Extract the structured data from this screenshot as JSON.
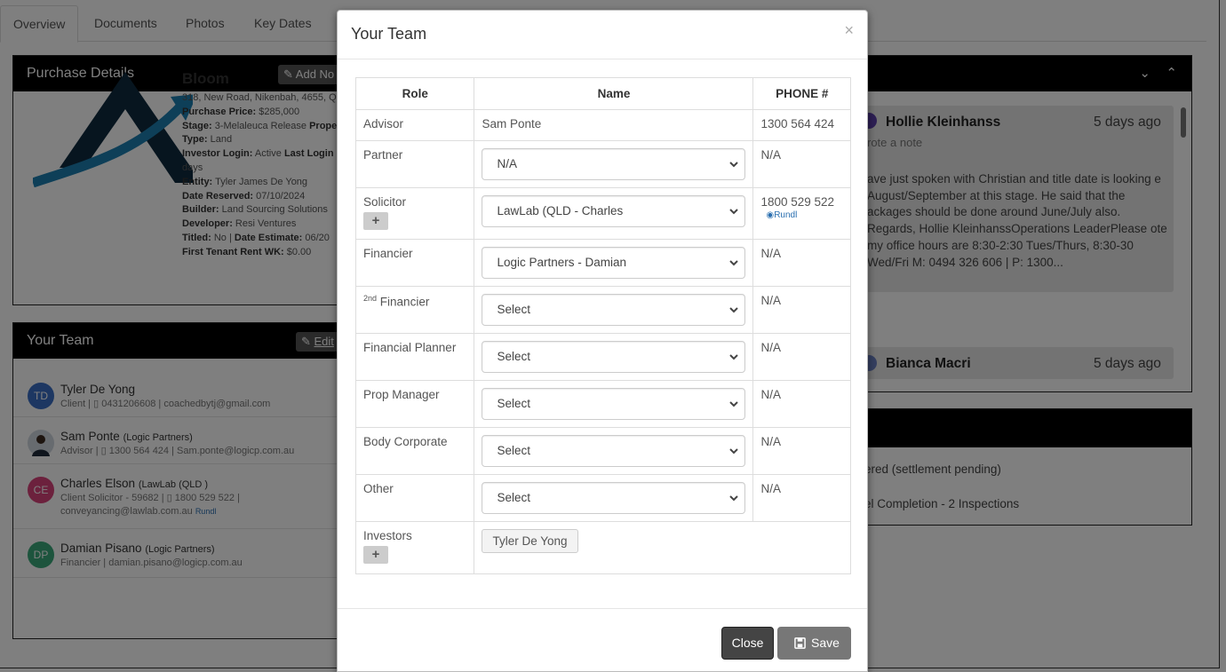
{
  "tabs": [
    "Overview",
    "Documents",
    "Photos",
    "Key Dates"
  ],
  "purchase": {
    "header": "Purchase Details",
    "add_note": "Add No",
    "name": "Bloom",
    "address": "318, New Road, Nikenbah, 4655, Q",
    "price_label": "Purchase Price:",
    "price": "$285,000",
    "stage_label": "Stage:",
    "stage": "3-Melaleuca Release",
    "stage_extra": "Prope",
    "type_label": "Type:",
    "type": "Land",
    "login_label": "Investor Login:",
    "login": "Active",
    "last_login_label": "Last Login",
    "days": "days",
    "entity_label": "Entity:",
    "entity": "Tyler James De Yong",
    "reserved_label": "Date Reserved:",
    "reserved": "07/10/2024",
    "builder_label": "Builder:",
    "builder": "Land Sourcing Solutions",
    "developer_label": "Developer:",
    "developer": "Resi Ventures",
    "titled_label": "Titled:",
    "titled": "No",
    "date_est_label": "Date Estimate:",
    "date_est": "06/20",
    "rent_label": "First Tenant Rent WK:",
    "rent": "$0.00"
  },
  "team_panel": {
    "header": "Your Team",
    "edit": "Edit",
    "members": [
      {
        "initials": "TD",
        "name": "Tyler De Yong",
        "company": "",
        "sub1": "Client | ▯ 0431206608 | coachedbytj@gmail.com",
        "sub2": "",
        "color": "#3a6fc4"
      },
      {
        "initials": "",
        "name": "Sam Ponte",
        "company": "(Logic Partners)",
        "sub1": "Advisor | ▯ 1300 564 424 | Sam.ponte@logicp.com.au",
        "sub2": "",
        "color": "#555"
      },
      {
        "initials": "CE",
        "name": "Charles Elson",
        "company": "(LawLab (QLD )",
        "sub1": "Client Solicitor - 59682 | ▯ 1800 529 522 |",
        "sub2": "conveyancing@lawlab.com.au",
        "color": "#d9437a"
      },
      {
        "initials": "DP",
        "name": "Damian Pisano",
        "company": "(Logic Partners)",
        "sub1": "Financier | damian.pisano@logicp.com.au",
        "sub2": "",
        "color": "#3aa87a"
      }
    ],
    "rundl": "Rundl"
  },
  "notes_panel": {
    "notes": [
      {
        "name": "Hollie Kleinhanss",
        "time": "5 days ago",
        "sub": "rote a note",
        "text": "ave just spoken with Christian and title date is looking e August/September at this stage. He said that the ackages should be done around June/July also. Regards, Hollie KleinhanssOperations LeaderPlease ote my office hours are 8:30-2:30 Tues/Thurs, 8:30-30 Wed/Fri M: 0494 326 606 |  P: 1300..."
      },
      {
        "name": "Bianca Macri",
        "time": "5 days ago"
      }
    ]
  },
  "status_panel": {
    "line1": "ered (settlement pending)",
    "line2": "el Completion - 2 Inspections"
  },
  "modal": {
    "title": "Your Team",
    "close_x": "×",
    "columns": [
      "Role",
      "Name",
      "PHONE #"
    ],
    "rows": [
      {
        "role": "Advisor",
        "value": "Sam Ponte",
        "phone": "1300 564 424"
      },
      {
        "role": "Partner",
        "value": "N/A",
        "phone": "N/A"
      },
      {
        "role": "Solicitor",
        "value": "LawLab (QLD - Charles",
        "phone": "1800 529 522",
        "extra": "Rundl"
      },
      {
        "role": "Financier",
        "value": "Logic Partners - Damian",
        "phone": "N/A"
      },
      {
        "role_sup": "2nd",
        "role": "Financier",
        "value": "Select",
        "phone": "N/A"
      },
      {
        "role": "Financial Planner",
        "value": "Select",
        "phone": "N/A"
      },
      {
        "role": "Prop Manager",
        "value": "Select",
        "phone": "N/A"
      },
      {
        "role": "Body Corporate",
        "value": "Select",
        "phone": "N/A"
      },
      {
        "role": "Other",
        "value": "Select",
        "phone": "N/A"
      }
    ],
    "investors_label": "Investors",
    "investor": "Tyler De Yong",
    "plus": "+",
    "close_btn": "Close",
    "save_btn": "Save"
  }
}
